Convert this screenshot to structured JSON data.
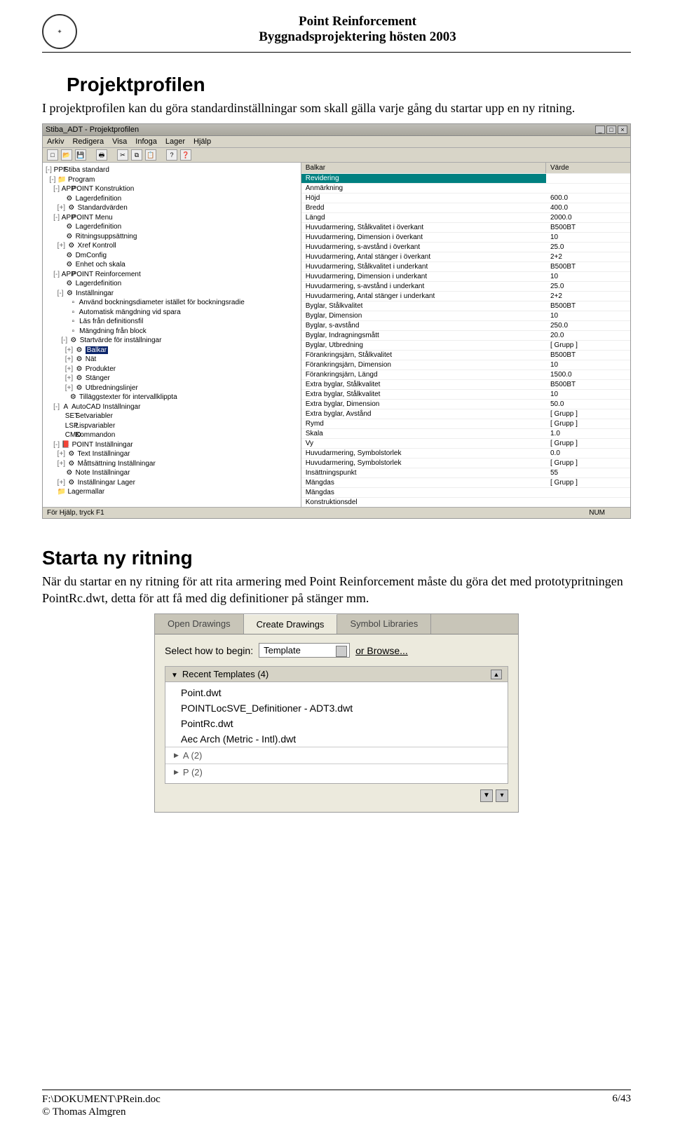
{
  "header": {
    "line1": "Point Reinforcement",
    "line2": "Byggnadsprojektering hösten 2003"
  },
  "section1": {
    "title": "Projektprofilen",
    "body": "I projektprofilen kan du göra standardinställningar som skall gälla varje gång du startar upp en ny ritning."
  },
  "win1": {
    "title": "Stiba_ADT - Projektprofilen",
    "menus": [
      "Arkiv",
      "Redigera",
      "Visa",
      "Infoga",
      "Lager",
      "Hjälp"
    ],
    "status_left": "För Hjälp, tryck F1",
    "status_right": "NUM",
    "props_header": {
      "c1": "Balkar",
      "c2": "Värde"
    },
    "tree": [
      {
        "indent": 0,
        "exp": "-",
        "icon": "PPF",
        "label": "Stiba standard"
      },
      {
        "indent": 1,
        "exp": "-",
        "icon": "📁",
        "label": "Program"
      },
      {
        "indent": 2,
        "exp": "-",
        "icon": "APP",
        "label": "POINT Konstruktion"
      },
      {
        "indent": 3,
        "exp": " ",
        "icon": "⚙",
        "label": "Lagerdefinition"
      },
      {
        "indent": 3,
        "exp": "+",
        "icon": "⚙",
        "label": "Standardvärden"
      },
      {
        "indent": 2,
        "exp": "-",
        "icon": "APP",
        "label": "POINT Menu"
      },
      {
        "indent": 3,
        "exp": " ",
        "icon": "⚙",
        "label": "Lagerdefinition"
      },
      {
        "indent": 3,
        "exp": " ",
        "icon": "⚙",
        "label": "Ritningsuppsättning"
      },
      {
        "indent": 3,
        "exp": "+",
        "icon": "⚙",
        "label": "Xref Kontroll"
      },
      {
        "indent": 3,
        "exp": " ",
        "icon": "⚙",
        "label": "DmConfig"
      },
      {
        "indent": 3,
        "exp": " ",
        "icon": "⚙",
        "label": "Enhet och skala"
      },
      {
        "indent": 2,
        "exp": "-",
        "icon": "APP",
        "label": "POINT Reinforcement"
      },
      {
        "indent": 3,
        "exp": " ",
        "icon": "⚙",
        "label": "Lagerdefinition"
      },
      {
        "indent": 3,
        "exp": "-",
        "icon": "⚙",
        "label": "Inställningar"
      },
      {
        "indent": 4,
        "exp": " ",
        "icon": "▫",
        "label": "Använd bockningsdiameter istället för bockningsradie"
      },
      {
        "indent": 4,
        "exp": " ",
        "icon": "▫",
        "label": "Automatisk mängdning vid spara"
      },
      {
        "indent": 4,
        "exp": " ",
        "icon": "▫",
        "label": "Läs från definitionsfil"
      },
      {
        "indent": 4,
        "exp": " ",
        "icon": "▫",
        "label": "Mängdning från block"
      },
      {
        "indent": 4,
        "exp": "-",
        "icon": "⚙",
        "label": "Startvärde för inställningar"
      },
      {
        "indent": 5,
        "exp": "+",
        "icon": "⚙",
        "label": "Balkar",
        "selected": true
      },
      {
        "indent": 5,
        "exp": "+",
        "icon": "⚙",
        "label": "Nät"
      },
      {
        "indent": 5,
        "exp": "+",
        "icon": "⚙",
        "label": "Produkter"
      },
      {
        "indent": 5,
        "exp": "+",
        "icon": "⚙",
        "label": "Stänger"
      },
      {
        "indent": 5,
        "exp": "+",
        "icon": "⚙",
        "label": "Utbredningslinjer"
      },
      {
        "indent": 4,
        "exp": " ",
        "icon": "⚙",
        "label": "Tilläggstexter för intervallklippta"
      },
      {
        "indent": 2,
        "exp": "-",
        "icon": "A",
        "label": "AutoCAD Inställningar"
      },
      {
        "indent": 3,
        "exp": " ",
        "icon": "SET",
        "label": "Setvariabler"
      },
      {
        "indent": 3,
        "exp": " ",
        "icon": "LSP",
        "label": "Lispvariabler"
      },
      {
        "indent": 3,
        "exp": " ",
        "icon": "CMD",
        "label": "Kommandon"
      },
      {
        "indent": 2,
        "exp": "-",
        "icon": "📕",
        "label": "POINT Inställningar"
      },
      {
        "indent": 3,
        "exp": "+",
        "icon": "⚙",
        "label": "Text Inställningar"
      },
      {
        "indent": 3,
        "exp": "+",
        "icon": "⚙",
        "label": "Måttsättning Inställningar"
      },
      {
        "indent": 3,
        "exp": " ",
        "icon": "⚙",
        "label": "Note Inställningar"
      },
      {
        "indent": 3,
        "exp": "+",
        "icon": "⚙",
        "label": "Inställningar Lager"
      },
      {
        "indent": 1,
        "exp": " ",
        "icon": "📁",
        "label": "Lagermallar"
      }
    ],
    "props": [
      {
        "c1": "Revidering",
        "c2": "",
        "hl": true
      },
      {
        "c1": "Anmärkning",
        "c2": ""
      },
      {
        "c1": "Höjd",
        "c2": "600.0"
      },
      {
        "c1": "Bredd",
        "c2": "400.0"
      },
      {
        "c1": "Längd",
        "c2": "2000.0"
      },
      {
        "c1": "Huvudarmering, Stålkvalitet i överkant",
        "c2": "B500BT"
      },
      {
        "c1": "Huvudarmering, Dimension i överkant",
        "c2": "10"
      },
      {
        "c1": "Huvudarmering, s-avstånd i överkant",
        "c2": "25.0"
      },
      {
        "c1": "Huvudarmering, Antal stänger i överkant",
        "c2": "2+2"
      },
      {
        "c1": "Huvudarmering, Stålkvalitet i underkant",
        "c2": "B500BT"
      },
      {
        "c1": "Huvudarmering, Dimension i underkant",
        "c2": "10"
      },
      {
        "c1": "Huvudarmering, s-avstånd i underkant",
        "c2": "25.0"
      },
      {
        "c1": "Huvudarmering, Antal stänger i underkant",
        "c2": "2+2"
      },
      {
        "c1": "Byglar, Stålkvalitet",
        "c2": "B500BT"
      },
      {
        "c1": "Byglar, Dimension",
        "c2": "10"
      },
      {
        "c1": "Byglar, s-avstånd",
        "c2": "250.0"
      },
      {
        "c1": "Byglar, Indragningsmått",
        "c2": "20.0"
      },
      {
        "c1": "Byglar, Utbredning",
        "c2": "[ Grupp ]"
      },
      {
        "c1": "Förankringsjärn, Stålkvalitet",
        "c2": "B500BT"
      },
      {
        "c1": "Förankringsjärn, Dimension",
        "c2": "10"
      },
      {
        "c1": "Förankringsjärn, Längd",
        "c2": "1500.0"
      },
      {
        "c1": "Extra byglar, Stålkvalitet",
        "c2": "B500BT"
      },
      {
        "c1": "Extra byglar, Stålkvalitet",
        "c2": "10"
      },
      {
        "c1": "Extra byglar, Dimension",
        "c2": "50.0"
      },
      {
        "c1": "Extra byglar, Avstånd",
        "c2": "[ Grupp ]"
      },
      {
        "c1": "Rymd",
        "c2": "[ Grupp ]"
      },
      {
        "c1": "Skala",
        "c2": "1.0"
      },
      {
        "c1": "Vy",
        "c2": "[ Grupp ]"
      },
      {
        "c1": "Huvudarmering, Symbolstorlek",
        "c2": "0.0"
      },
      {
        "c1": "Huvudarmering, Symbolstorlek",
        "c2": "[ Grupp ]"
      },
      {
        "c1": "Insättningspunkt",
        "c2": "55"
      },
      {
        "c1": "Mängdas",
        "c2": "[ Grupp ]"
      },
      {
        "c1": "Mängdas",
        "c2": ""
      },
      {
        "c1": "Konstruktionsdel",
        "c2": ""
      }
    ]
  },
  "section2": {
    "title": "Starta ny ritning",
    "body": "När du startar en ny ritning för att rita armering med Point Reinforcement måste du göra det med prototypritningen PointRc.dwt, detta för att få med dig definitioner på stänger mm."
  },
  "win2": {
    "tabs": [
      "Open Drawings",
      "Create Drawings",
      "Symbol Libraries"
    ],
    "active_tab": 1,
    "begin_label": "Select how to begin:",
    "begin_value": "Template",
    "browse": "or Browse...",
    "group": "Recent Templates (4)",
    "items": [
      "Point.dwt",
      "POINTLocSVE_Definitioner - ADT3.dwt",
      "PointRc.dwt",
      "Aec Arch (Metric - Intl).dwt"
    ],
    "sub": [
      "A (2)",
      "P (2)"
    ]
  },
  "footer": {
    "left1": "F:\\DOKUMENT\\PRein.doc",
    "left2": "© Thomas Almgren",
    "page": "6/43"
  }
}
